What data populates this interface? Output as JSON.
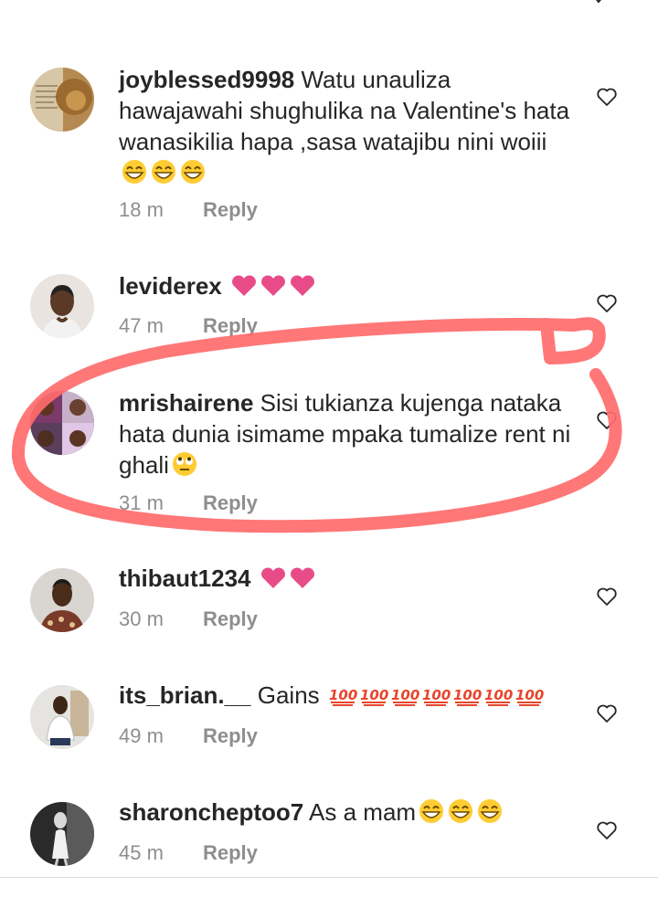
{
  "colors": {
    "annotation": "#ff6b6b",
    "text": "#262626",
    "muted": "#8e8e8e",
    "heart_emoji": "#e84c88"
  },
  "comments": [
    {
      "username": "joyblessed9998",
      "text": " Watu unauliza hawajawahi shughulika na Valentine's hata wanasikilia hapa ,sasa watajibu nini woiii",
      "emoji": [
        "grin-emoji",
        "grin-emoji",
        "grin-emoji"
      ],
      "time": "18 m",
      "reply": "Reply"
    },
    {
      "username": "leviderex",
      "text": " ",
      "emoji": [
        "pink-heart-emoji",
        "pink-heart-emoji",
        "pink-heart-emoji"
      ],
      "time": "47 m",
      "reply": "Reply"
    },
    {
      "username": "mrishairene",
      "text": " Sisi tukianza kujenga nataka hata dunia isimame mpaka tumalize rent ni ghali",
      "emoji": [
        "eye-roll-emoji"
      ],
      "time": "31 m",
      "reply": "Reply"
    },
    {
      "username": "thibaut1234",
      "text": " ",
      "emoji": [
        "pink-heart-emoji",
        "pink-heart-emoji"
      ],
      "time": "30 m",
      "reply": "Reply"
    },
    {
      "username": "its_brian.__",
      "text": " Gains ",
      "emoji": [
        "hundred-emoji",
        "hundred-emoji",
        "hundred-emoji",
        "hundred-emoji",
        "hundred-emoji",
        "hundred-emoji",
        "hundred-emoji"
      ],
      "time": "49 m",
      "reply": "Reply"
    },
    {
      "username": "sharoncheptoo7",
      "text": " As a mam",
      "emoji": [
        "grin-emoji",
        "grin-emoji",
        "grin-emoji"
      ],
      "time": "45 m",
      "reply": "Reply"
    }
  ]
}
